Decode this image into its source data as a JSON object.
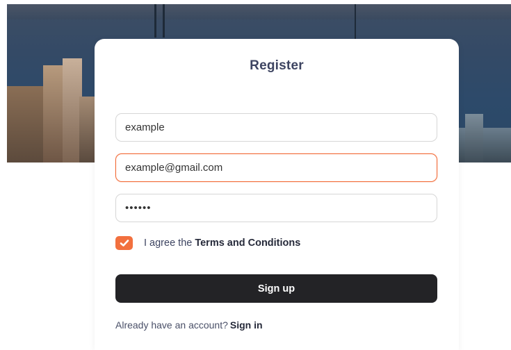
{
  "form": {
    "title": "Register",
    "fields": {
      "username": {
        "value": "example"
      },
      "email": {
        "value": "example@gmail.com"
      },
      "password": {
        "value": "••••••"
      }
    },
    "agree": {
      "checked": true,
      "text": "I agree the",
      "link": "Terms and Conditions"
    },
    "submit_label": "Sign up",
    "footer": {
      "text": "Already have an account?",
      "link": "Sign in"
    }
  },
  "colors": {
    "accent": "#f2703e",
    "button": "#232326",
    "title": "#3d4461"
  },
  "icons": {
    "checkbox": "checkmark-icon"
  }
}
